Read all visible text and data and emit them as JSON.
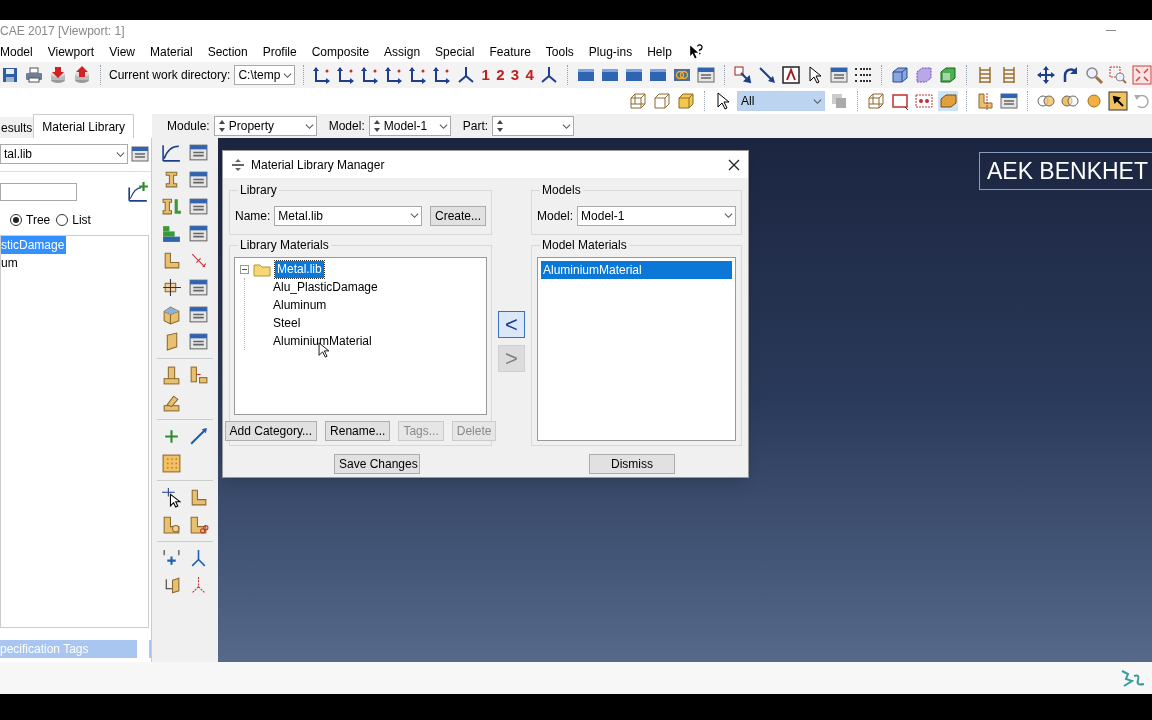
{
  "window": {
    "title": "CAE 2017 [Viewport: 1]"
  },
  "menu": [
    "Model",
    "Viewport",
    "View",
    "Material",
    "Section",
    "Profile",
    "Composite",
    "Assign",
    "Special",
    "Feature",
    "Tools",
    "Plug-ins",
    "Help"
  ],
  "toolbar": {
    "work_directory_label": "Current work directory:",
    "work_directory": "C:\\temp",
    "view_numbers": [
      "1",
      "2",
      "3",
      "4"
    ],
    "selection_filter": "All"
  },
  "context_bar": {
    "module_label": "Module:",
    "module": "Property",
    "model_label": "Model:",
    "model": "Model-1",
    "part_label": "Part:"
  },
  "left_panel": {
    "tabs": [
      {
        "label": "esults",
        "selected": false
      },
      {
        "label": "Material Library",
        "selected": true
      }
    ],
    "library": "tal.lib",
    "view_options": [
      {
        "label": "Tree",
        "selected": true
      },
      {
        "label": "List",
        "selected": false
      }
    ],
    "items": [
      {
        "label": "sticDamage",
        "selected": true
      },
      {
        "label": "um",
        "selected": false
      }
    ],
    "filter": "pecification Tags"
  },
  "viewport": {
    "annotation": "AEK BENKHET"
  },
  "dialog": {
    "title": "Material Library Manager",
    "library_group": "Library",
    "name_label": "Name:",
    "name": "Metal.lib",
    "create_button": "Create...",
    "library_materials_group": "Library Materials",
    "tree": {
      "label": "Metal.lib",
      "expanded": true,
      "selected": true,
      "children": [
        {
          "label": "Alu_PlasticDamage",
          "selected": false
        },
        {
          "label": "Aluminum",
          "selected": false
        },
        {
          "label": "Steel",
          "selected": false
        },
        {
          "label": "AluminiumMaterial",
          "selected": false
        }
      ]
    },
    "library_buttons": [
      {
        "label": "Add Category...",
        "disabled": false
      },
      {
        "label": "Rename...",
        "disabled": false
      },
      {
        "label": "Tags...",
        "disabled": true
      },
      {
        "label": "Delete",
        "disabled": true
      }
    ],
    "transfer_buttons": [
      {
        "label": "<",
        "disabled": false
      },
      {
        "label": ">",
        "disabled": true
      }
    ],
    "models_group": "Models",
    "model_label": "Model:",
    "model": "Model-1",
    "model_materials_group": "Model Materials",
    "model_materials": [
      {
        "label": "AluminiumMaterial",
        "selected": true
      }
    ],
    "footer_buttons": [
      "Save Changes",
      "Dismiss"
    ]
  }
}
